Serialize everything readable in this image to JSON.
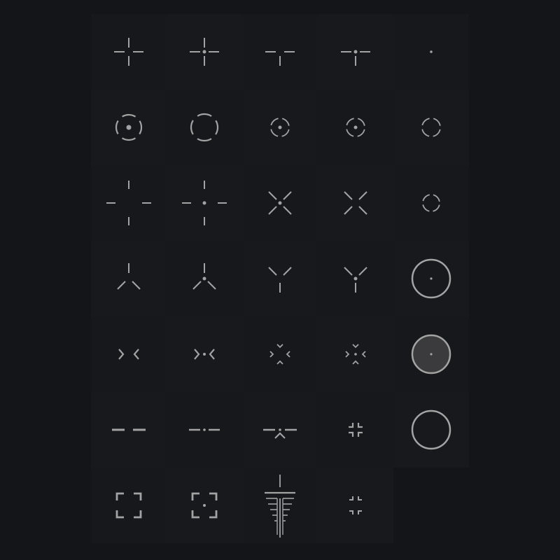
{
  "colors": {
    "background": "#141519",
    "tile": "#17181b",
    "tile_alt": "#18191d",
    "stroke": "#a3a3a3",
    "fill_disc": "#3b3b3d"
  },
  "crosshairs": [
    {
      "icon": "crosshair-plus-icon"
    },
    {
      "icon": "crosshair-plus-dot-icon"
    },
    {
      "icon": "crosshair-t-icon"
    },
    {
      "icon": "crosshair-t-dot-icon"
    },
    {
      "icon": "crosshair-dot-icon"
    },
    {
      "icon": "crosshair-circle-dot-icon"
    },
    {
      "icon": "crosshair-circle-icon"
    },
    {
      "icon": "crosshair-small-circle-dot-icon"
    },
    {
      "icon": "crosshair-small-circle-dot-alt-icon"
    },
    {
      "icon": "crosshair-small-circle-icon"
    },
    {
      "icon": "crosshair-wide-plus-icon"
    },
    {
      "icon": "crosshair-wide-plus-dot-icon"
    },
    {
      "icon": "crosshair-x-dot-icon"
    },
    {
      "icon": "crosshair-x-icon"
    },
    {
      "icon": "crosshair-tiny-circle-icon"
    },
    {
      "icon": "crosshair-tripod-icon"
    },
    {
      "icon": "crosshair-tripod-dot-icon"
    },
    {
      "icon": "crosshair-y-icon"
    },
    {
      "icon": "crosshair-y-dot-icon"
    },
    {
      "icon": "crosshair-ring-dot-icon"
    },
    {
      "icon": "crosshair-chevrons-icon"
    },
    {
      "icon": "crosshair-chevrons-dot-icon"
    },
    {
      "icon": "crosshair-four-chevrons-icon"
    },
    {
      "icon": "crosshair-four-chevrons-dot-icon"
    },
    {
      "icon": "crosshair-filled-ring-dot-icon"
    },
    {
      "icon": "crosshair-dash-icon"
    },
    {
      "icon": "crosshair-dash-dot-icon"
    },
    {
      "icon": "crosshair-dash-chevron-icon"
    },
    {
      "icon": "crosshair-corners-small-icon"
    },
    {
      "icon": "crosshair-ring-icon"
    },
    {
      "icon": "crosshair-brackets-icon"
    },
    {
      "icon": "crosshair-brackets-dot-icon"
    },
    {
      "icon": "crosshair-rangefinder-icon"
    },
    {
      "icon": "crosshair-corners-tiny-icon"
    },
    {
      "icon": ""
    }
  ]
}
